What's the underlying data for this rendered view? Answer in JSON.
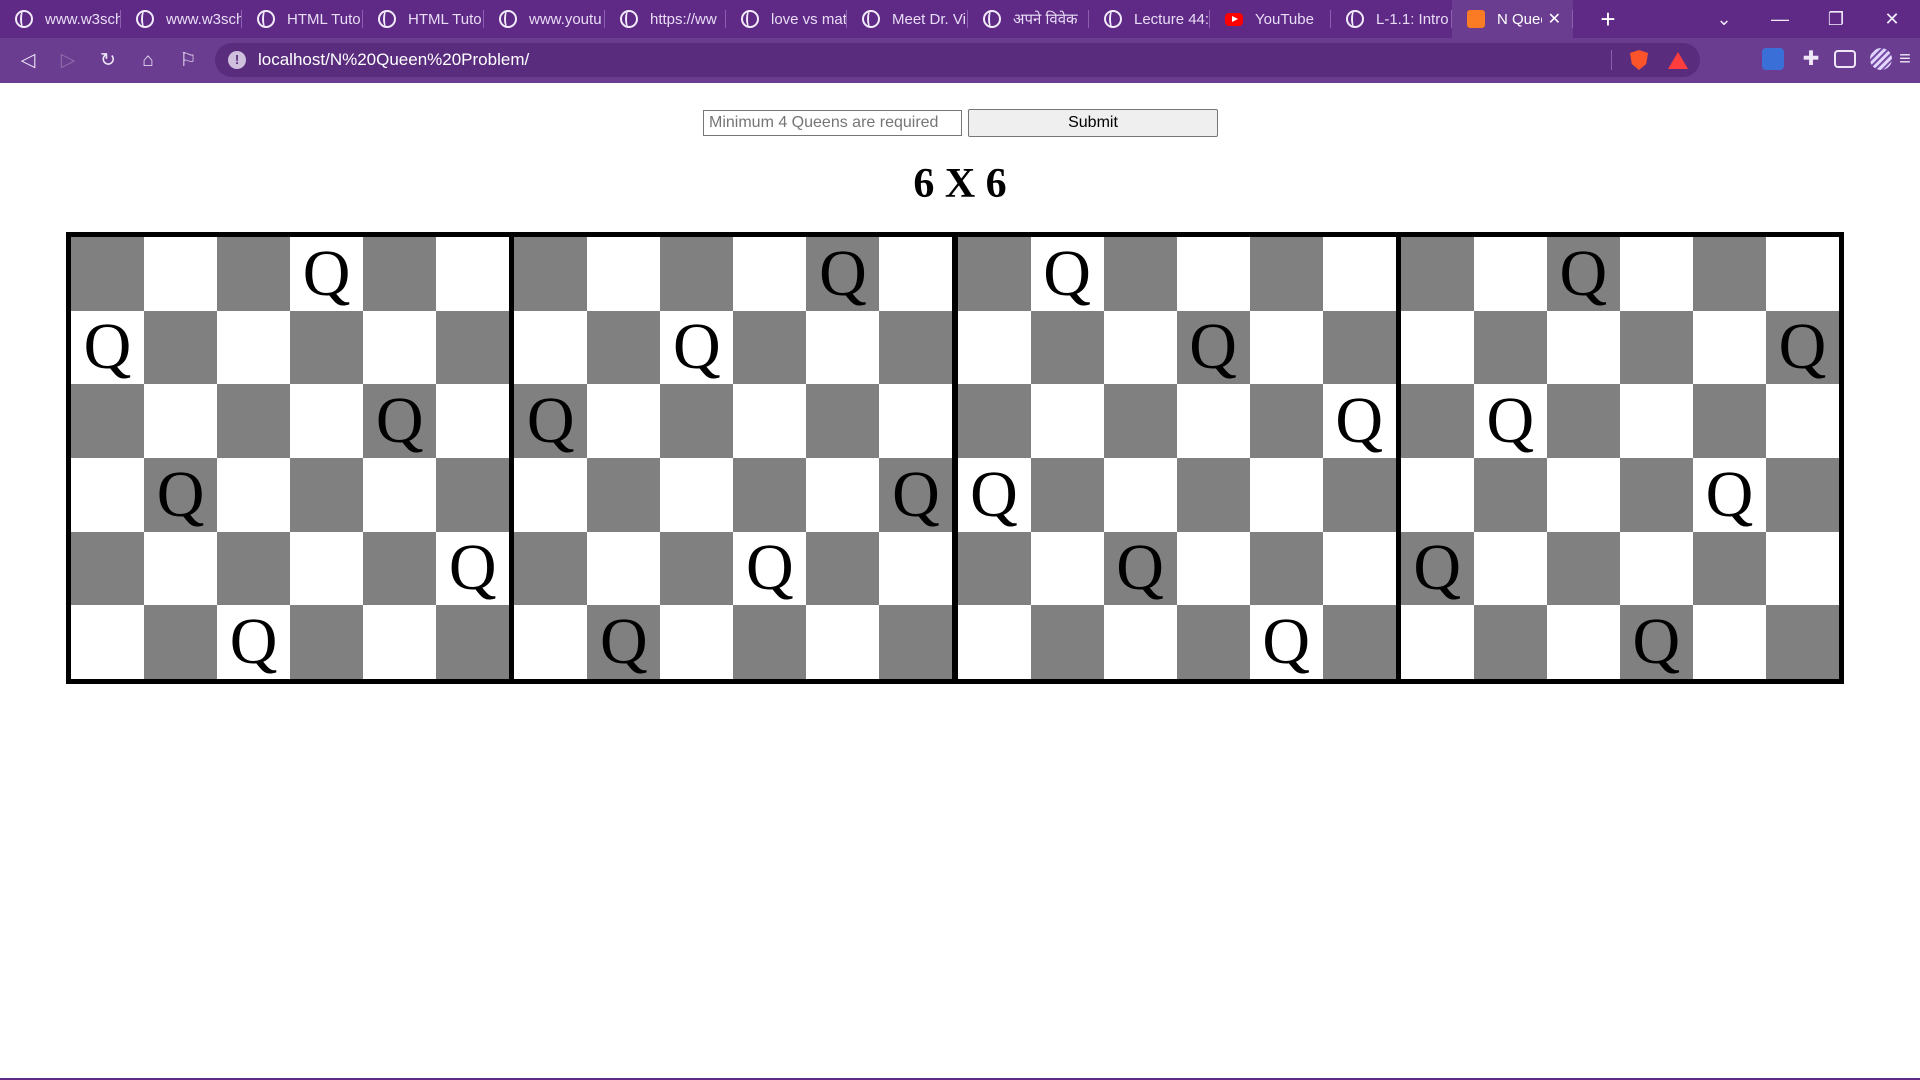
{
  "browser": {
    "tabs": [
      {
        "label": "www.w3sch",
        "icon": "globe-icon"
      },
      {
        "label": "www.w3sch",
        "icon": "globe-icon"
      },
      {
        "label": "HTML Tuto",
        "icon": "globe-icon"
      },
      {
        "label": "HTML Tuto",
        "icon": "globe-icon"
      },
      {
        "label": "www.youtu",
        "icon": "globe-icon"
      },
      {
        "label": "https://ww",
        "icon": "globe-icon"
      },
      {
        "label": "love vs mat",
        "icon": "globe-icon"
      },
      {
        "label": "Meet Dr. Vi",
        "icon": "globe-icon"
      },
      {
        "label": "अपने विवेक",
        "icon": "globe-icon"
      },
      {
        "label": "Lecture 44:",
        "icon": "globe-icon"
      },
      {
        "label": "YouTube",
        "icon": "youtube-icon"
      },
      {
        "label": "L-1.1: Intro",
        "icon": "globe-icon"
      },
      {
        "label": "N Quee",
        "icon": "xampp-icon",
        "active": true
      }
    ],
    "new_tab": "+",
    "url": "localhost/N%20Queen%20Problem/",
    "colors": {
      "chrome": "#5e2a86",
      "toolbar": "#6a3d91"
    }
  },
  "form": {
    "input_placeholder": "Minimum 4 Queens are required",
    "input_value": "",
    "submit_label": "Submit"
  },
  "heading": "6 X 6",
  "board": {
    "size": 6,
    "queen_symbol": "Q",
    "dark_color": "#808080",
    "light_color": "#ffffff",
    "solutions": [
      [
        3,
        0,
        4,
        1,
        5,
        2
      ],
      [
        4,
        2,
        0,
        5,
        3,
        1
      ],
      [
        1,
        3,
        5,
        0,
        2,
        4
      ],
      [
        2,
        5,
        1,
        4,
        0,
        3
      ]
    ]
  }
}
